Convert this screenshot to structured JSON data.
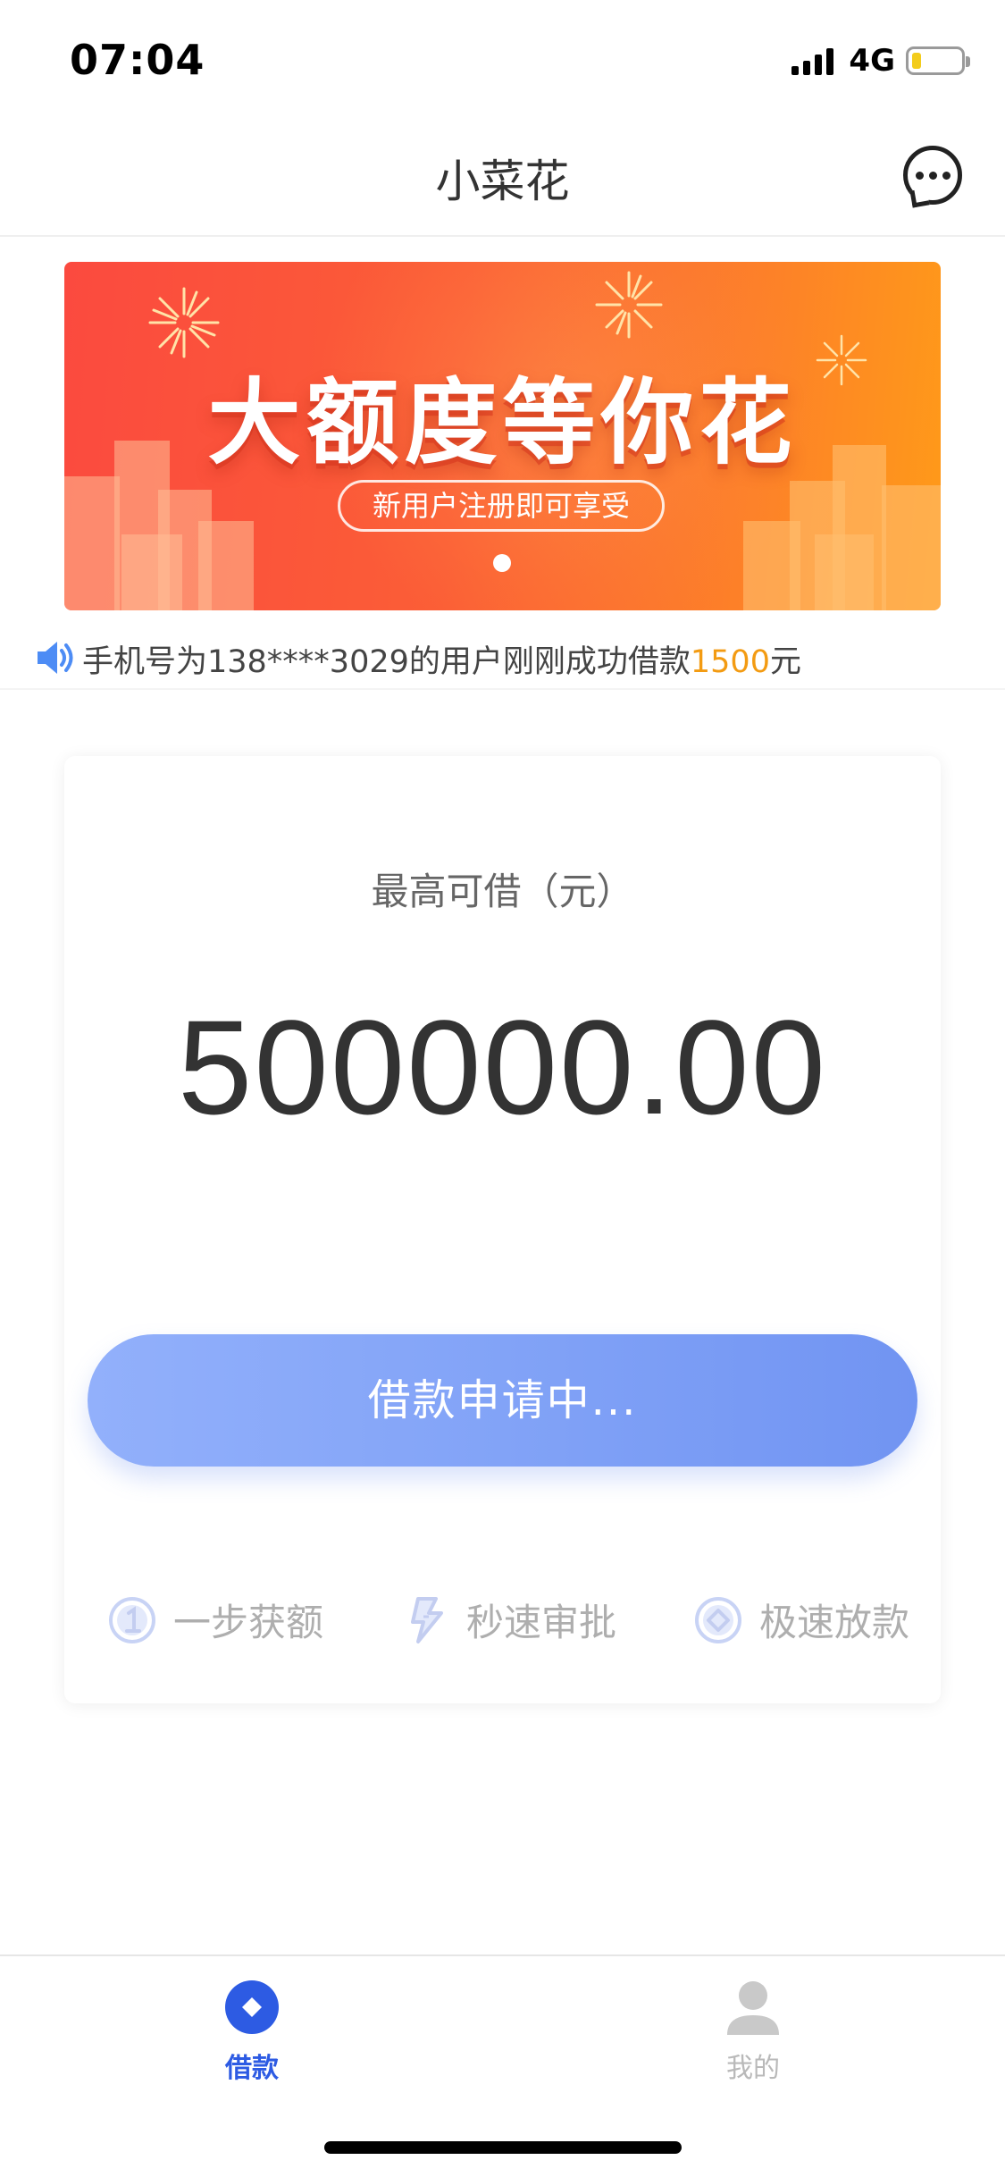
{
  "status_bar": {
    "time": "07:04",
    "network": "4G",
    "battery_level": 0.2
  },
  "nav": {
    "title": "小菜花",
    "more_icon": "chat-more-icon"
  },
  "banner": {
    "title": "大额度等你花",
    "subtitle": "新用户注册即可享受",
    "page_count": 1,
    "active_page": 0
  },
  "notice": {
    "icon": "speaker-icon",
    "prefix": "手机号为138****3029的用户刚刚成功借款",
    "amount": "1500",
    "suffix": "元"
  },
  "loan_card": {
    "label": "最高可借（元）",
    "amount": "500000.00",
    "button_label": "借款申请中...",
    "features": [
      {
        "icon": "number-one-icon",
        "label": "一步获额"
      },
      {
        "icon": "lightning-icon",
        "label": "秒速审批"
      },
      {
        "icon": "diamond-coin-icon",
        "label": "极速放款"
      }
    ]
  },
  "tab_bar": {
    "tabs": [
      {
        "label": "借款",
        "icon": "loan-icon",
        "active": true
      },
      {
        "label": "我的",
        "icon": "user-icon",
        "active": false
      }
    ]
  },
  "colors": {
    "accent": "#2d5be3",
    "button_start": "#92b0fb",
    "button_end": "#7194f2",
    "highlight_amount": "#f39b12",
    "banner_start": "#fb4a3f",
    "banner_end": "#ff9a19"
  }
}
